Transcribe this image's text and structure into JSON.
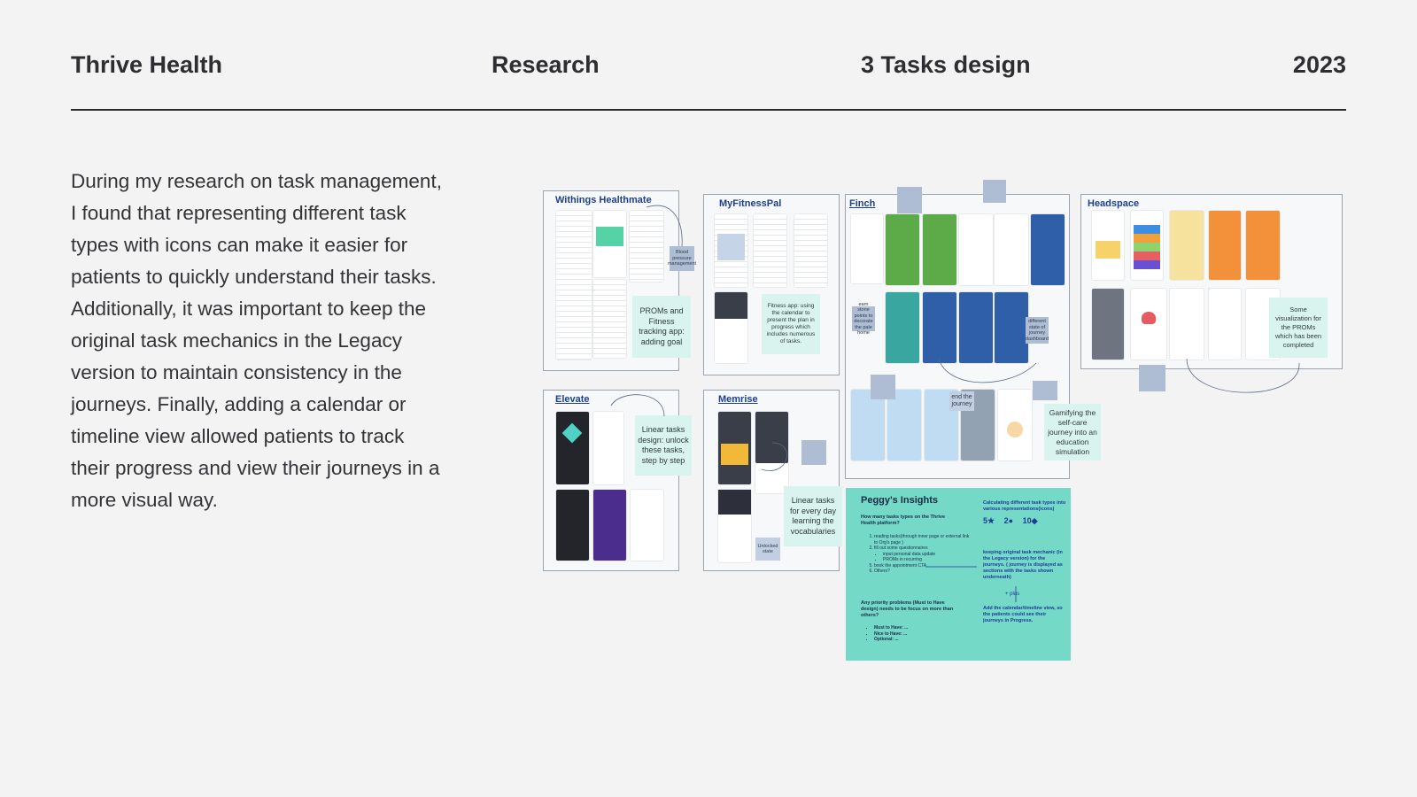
{
  "header": {
    "project": "Thrive Health",
    "section": "Research",
    "topic": "3 Tasks design",
    "year": "2023"
  },
  "intro": "During my research on task management, I found that representing different task types with icons can make it easier for patients to quickly understand their tasks. Additionally, it was important to keep the original task mechanics in the Legacy version to maintain consistency in the journeys. Finally, adding a calendar or timeline view allowed patients to track their progress and view their journeys in a more visual way.",
  "boards": {
    "withings": {
      "title": "Withings Healthmate",
      "note": "PROMs and Fitness tracking app: adding goal",
      "tag": "Blood pressure management"
    },
    "myfitnesspal": {
      "title": "MyFitnessPal",
      "note": "Fitness app: using the calendar to present the plan in progress which includes numerous of tasks."
    },
    "finch": {
      "title": "Finch",
      "note": "Gamifying the self-care journey into an education simulation",
      "tag_end": "end the journey",
      "tag_earn": "earn stone points to decorate the pale home",
      "tag_states": "different state of journey dashboard"
    },
    "headspace": {
      "title": "Headspace",
      "note": "Some visualization for the PROMs which has been completed"
    },
    "elevate": {
      "title": "Elevate",
      "note": "Linear tasks design: unlock these tasks, step by step"
    },
    "memrise": {
      "title": "Memrise",
      "note": "Linear tasks for every day learning the vocabularies",
      "tag_unlocked": "Unlocked state"
    }
  },
  "insights": {
    "title": "Peggy's Insights",
    "question1": "How many tasks types on the Thrive Health platform?",
    "list1": [
      "reading tasks(through inner page or external link to Org's page )",
      "fill out some questionnaires",
      "input personal data update",
      "PROMs in recurring",
      "book the appointment CTA",
      "Others?"
    ],
    "question2": "Any priority problems (Must to Have design) needs to be focus on more than others?",
    "list2": [
      "Must to Have: ...",
      "Nice to Have: ...",
      "Optional: ..."
    ],
    "right1": "Calculating different task types into various representations(icons)",
    "icon_counts": [
      "5★",
      "2●",
      "10◆"
    ],
    "right2": "keeping original task mechanic (in the Legacy version) for the journeys. ( journey is displayed as sections with the tasks shown underneath)",
    "plus": "+ plus",
    "right3": "Add the calendar/timeline view, so the patients could see their journeys in Progress."
  },
  "colors": {
    "background": "#f3f3f3",
    "text": "#2d2d32",
    "board_title": "#1d3f8f",
    "note": "#d9f4ee",
    "insights_bg": "#74d9c7",
    "finch_green": "#5dab48",
    "finch_blue": "#2f5fa8",
    "headspace_orange": "#f2913a"
  }
}
